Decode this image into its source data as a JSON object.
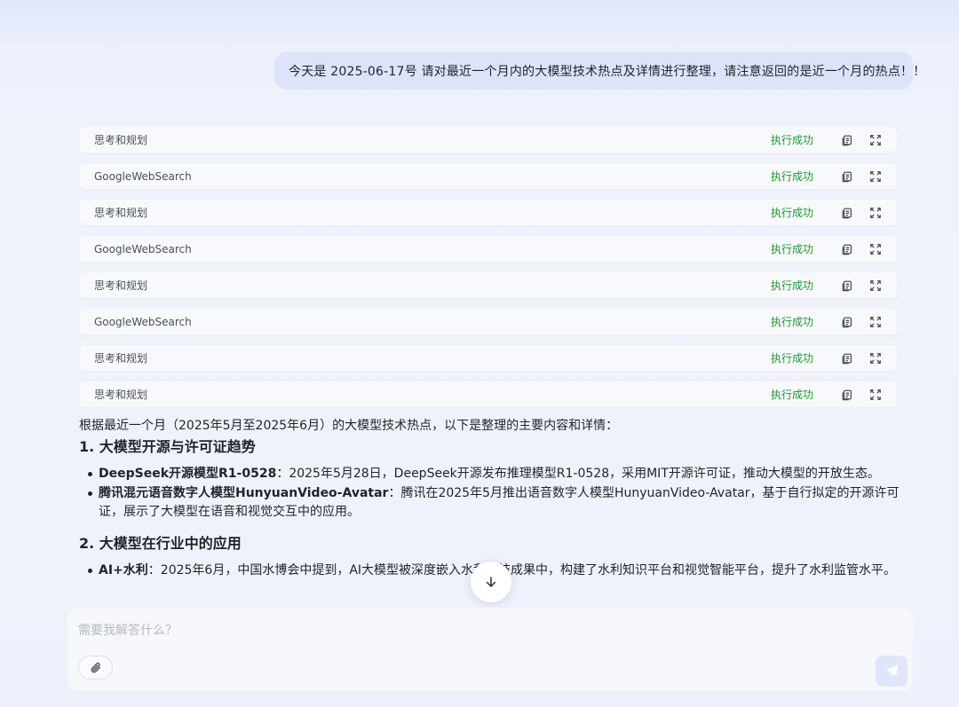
{
  "user_message": "今天是 2025-06-17号 请对最近一个月内的大模型技术热点及详情进行整理，请注意返回的是近一个月的热点！！",
  "steps": [
    {
      "name": "思考和规划",
      "status": "执行成功"
    },
    {
      "name": "GoogleWebSearch",
      "status": "执行成功"
    },
    {
      "name": "思考和规划",
      "status": "执行成功"
    },
    {
      "name": "GoogleWebSearch",
      "status": "执行成功"
    },
    {
      "name": "思考和规划",
      "status": "执行成功"
    },
    {
      "name": "GoogleWebSearch",
      "status": "执行成功"
    },
    {
      "name": "思考和规划",
      "status": "执行成功"
    },
    {
      "name": "思考和规划",
      "status": "执行成功"
    }
  ],
  "answer": {
    "intro": "根据最近一个月（2025年5月至2025年6月）的大模型技术热点，以下是整理的主要内容和详情：",
    "sections": [
      {
        "heading": "1. 大模型开源与许可证趋势",
        "items": [
          {
            "title": "DeepSeek开源模型R1-0528",
            "text": "：2025年5月28日，DeepSeek开源发布推理模型R1-0528，采用MIT开源许可证，推动大模型的开放生态。"
          },
          {
            "title": "腾讯混元语音数字人模型HunyuanVideo-Avatar",
            "text": "：腾讯在2025年5月推出语音数字人模型HunyuanVideo-Avatar，基于自行拟定的开源许可证，展示了大模型在语音和视觉交互中的应用。"
          }
        ]
      },
      {
        "heading": "2. 大模型在行业中的应用",
        "items": [
          {
            "title": "AI+水利",
            "text": "：2025年6月，中国水博会中提到，AI大模型被深度嵌入水利科技成果中，构建了水利知识平台和视觉智能平台，提升了水利监管水平。"
          }
        ]
      }
    ]
  },
  "input": {
    "placeholder": "需要我解答什么？",
    "value": ""
  },
  "icons": {
    "copy": "copy-icon",
    "expand": "expand-icon",
    "scroll": "arrow-down-icon",
    "attach": "paperclip-icon",
    "send": "send-icon"
  },
  "colors": {
    "success": "#1a9a2e",
    "bubble": "#dde4fa",
    "send_button": "#dfe6fa"
  }
}
